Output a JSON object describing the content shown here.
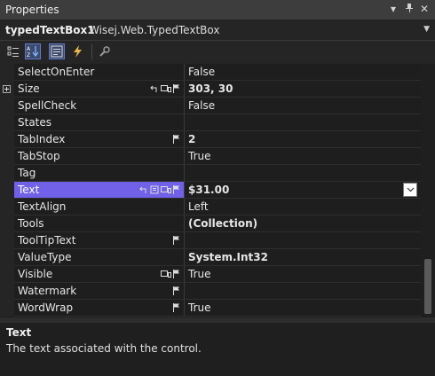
{
  "window": {
    "title": "Properties"
  },
  "object": {
    "name": "typedTextBox1",
    "type": "Wisej.Web.TypedTextBox"
  },
  "toolbar": {
    "buttons": [
      {
        "name": "categorized-icon",
        "active": false
      },
      {
        "name": "alphabetical-icon",
        "active": true
      },
      {
        "name": "properties-icon",
        "active": true
      },
      {
        "name": "events-icon",
        "active": false
      },
      {
        "name": "property-pages-icon",
        "active": false
      }
    ]
  },
  "properties": [
    {
      "name": "SelectOnEnter",
      "value": "False",
      "bold": false,
      "expandable": false,
      "icons": []
    },
    {
      "name": "Size",
      "value": "303, 30",
      "bold": true,
      "expandable": true,
      "icons": [
        "reset-icon",
        "responsive-icon",
        "flag-icon"
      ]
    },
    {
      "name": "SpellCheck",
      "value": "False",
      "bold": false,
      "expandable": false,
      "icons": []
    },
    {
      "name": "States",
      "value": "",
      "bold": false,
      "expandable": false,
      "icons": []
    },
    {
      "name": "TabIndex",
      "value": "2",
      "bold": true,
      "expandable": false,
      "icons": [
        "flag-icon"
      ]
    },
    {
      "name": "TabStop",
      "value": "True",
      "bold": false,
      "expandable": false,
      "icons": []
    },
    {
      "name": "Tag",
      "value": "",
      "bold": false,
      "expandable": false,
      "icons": []
    },
    {
      "name": "Text",
      "value": "$31.00",
      "bold": true,
      "expandable": false,
      "selected": true,
      "icons": [
        "reset-icon",
        "localize-icon",
        "responsive-icon",
        "flag-icon"
      ]
    },
    {
      "name": "TextAlign",
      "value": "Left",
      "bold": false,
      "expandable": false,
      "icons": []
    },
    {
      "name": "Tools",
      "value": "(Collection)",
      "bold": true,
      "expandable": false,
      "icons": []
    },
    {
      "name": "ToolTipText",
      "value": "",
      "bold": false,
      "expandable": false,
      "icons": [
        "flag-icon"
      ]
    },
    {
      "name": "ValueType",
      "value": "System.Int32",
      "bold": true,
      "expandable": false,
      "icons": []
    },
    {
      "name": "Visible",
      "value": "True",
      "bold": false,
      "expandable": false,
      "icons": [
        "responsive-icon",
        "flag-icon"
      ]
    },
    {
      "name": "Watermark",
      "value": "",
      "bold": false,
      "expandable": false,
      "icons": [
        "flag-icon"
      ]
    },
    {
      "name": "WordWrap",
      "value": "True",
      "bold": false,
      "expandable": false,
      "icons": [
        "flag-icon"
      ]
    }
  ],
  "description": {
    "title": "Text",
    "text": "The text associated with the control."
  },
  "colors": {
    "selection": "#7160e8",
    "background": "#1e1e1e"
  }
}
